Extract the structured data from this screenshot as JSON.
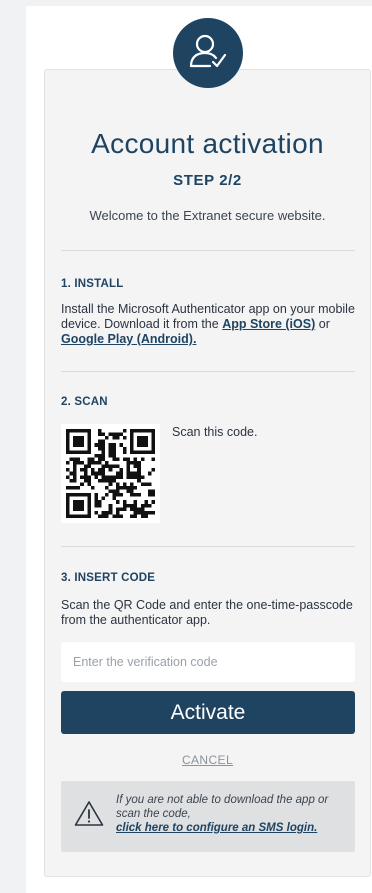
{
  "header": {
    "title": "Account activation",
    "step": "STEP 2/2",
    "welcome": "Welcome to the Extranet secure website."
  },
  "install": {
    "title": "1. INSTALL",
    "text_before": "Install the Microsoft Authenticator app on your mobile device. Download it from the ",
    "app_store_link": "App Store (iOS)",
    "or": " or ",
    "google_play_link": "Google Play (Android)."
  },
  "scan": {
    "title": "2. SCAN",
    "text": "Scan this code."
  },
  "insert_code": {
    "title": "3. INSERT CODE",
    "text": "Scan the QR Code and enter the one-time-passcode from the authenticator app.",
    "input_placeholder": "Enter the verification code",
    "input_value": ""
  },
  "actions": {
    "activate_label": "Activate",
    "cancel_label": "CANCEL"
  },
  "notice": {
    "text_line": "If you are not able to download the app or scan the code,",
    "link_text": "click here to configure an SMS login.",
    "icon": "warning-icon"
  },
  "colors": {
    "brand": "#1f4462",
    "page_background": "#f1f2f4",
    "card_background": "#f4f4f5",
    "notice_background": "#dfe0e2"
  }
}
